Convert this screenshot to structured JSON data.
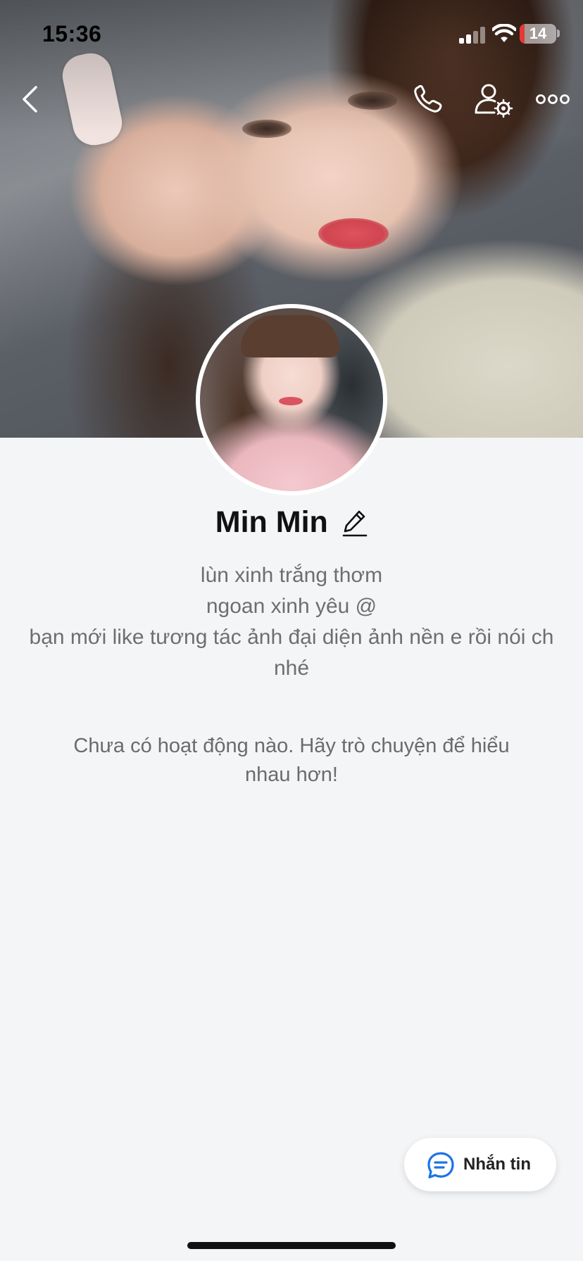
{
  "status_bar": {
    "time": "15:36",
    "battery": "14",
    "battery_level": 0.14
  },
  "header": {
    "back_icon": "chevron-left-icon",
    "call_icon": "phone-icon",
    "settings_icon": "user-settings-icon",
    "more_icon": "more-icon"
  },
  "profile": {
    "name": "Min Min",
    "bio_lines": [
      "lùn xinh trắng thơm",
      "ngoan xinh yêu @",
      "bạn mới like tương tác ảnh đại diện ảnh nền e rồi nói ch nhé"
    ]
  },
  "activity": {
    "empty_text": "Chưa có hoạt động nào. Hãy trò chuyện để hiểu nhau hơn!"
  },
  "message_button": {
    "label": "Nhắn tin",
    "icon": "chat-icon"
  },
  "colors": {
    "accent": "#1a73e8",
    "background": "#f4f5f7",
    "battery_low": "#e53935"
  }
}
